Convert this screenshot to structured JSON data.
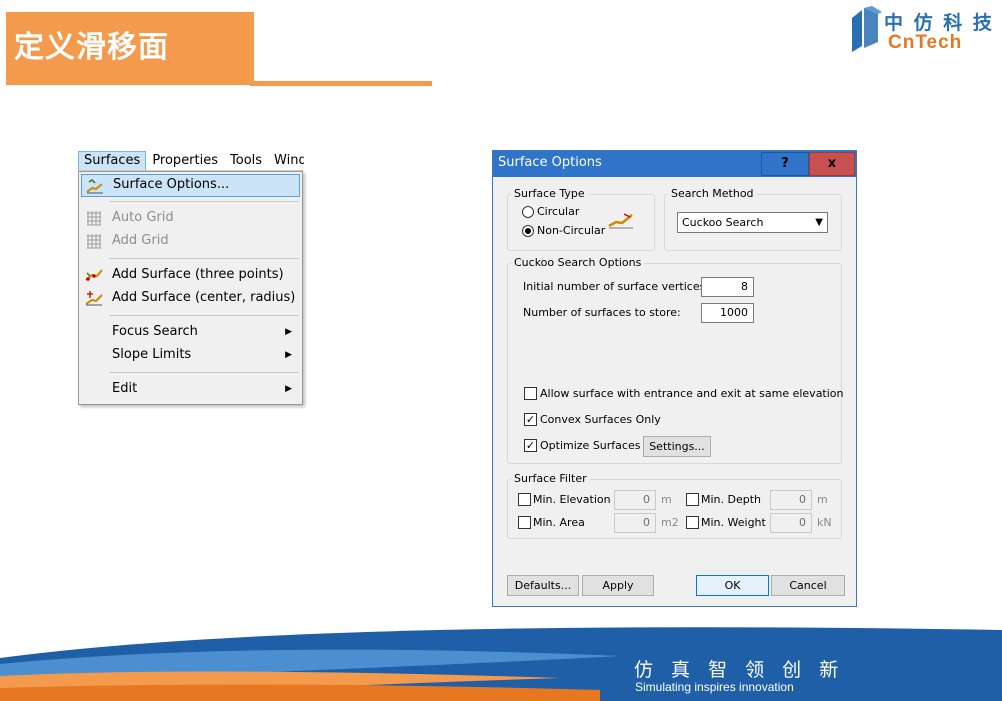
{
  "slide": {
    "title": "定义滑移面",
    "logo_cn": "中 仿 科 技",
    "logo_en": "CnTech",
    "slogan_cn": "仿 真 智 领 创 新",
    "slogan_en": "Simulating inspires innovation",
    "colors": {
      "accent": "#f39a4c",
      "brand_blue": "#2a6fb3",
      "brand_orange": "#e87722"
    }
  },
  "menubar": {
    "items": [
      "Surfaces",
      "Properties",
      "Tools",
      "Windo"
    ]
  },
  "menu": {
    "items": [
      {
        "label": "Surface Options...",
        "icon": "surface-options-icon"
      },
      {
        "label": "Auto Grid",
        "icon": "auto-grid-icon",
        "disabled": true
      },
      {
        "label": "Add Grid",
        "icon": "add-grid-icon",
        "disabled": true
      },
      {
        "label": "Add Surface (three points)",
        "icon": "add-surface-three-points-icon"
      },
      {
        "label": "Add Surface (center, radius)",
        "icon": "add-surface-center-radius-icon"
      },
      {
        "label": "Focus Search",
        "submenu": true
      },
      {
        "label": "Slope Limits",
        "submenu": true
      },
      {
        "label": "Edit",
        "submenu": true
      }
    ]
  },
  "dialog": {
    "title": "Surface Options",
    "help_button": "?",
    "close_button": "x",
    "surface_type": {
      "label": "Surface Type",
      "options": [
        "Circular",
        "Non-Circular"
      ],
      "selected": "Non-Circular"
    },
    "search_method": {
      "label": "Search Method",
      "value": "Cuckoo Search"
    },
    "cuckoo": {
      "label": "Cuckoo Search Options",
      "vertices_label": "Initial number of surface vertices:",
      "vertices_value": "8",
      "store_label": "Number of surfaces to store:",
      "store_value": "1000",
      "allow_same_elev": "Allow surface with entrance and exit at same elevation",
      "allow_same_elev_checked": false,
      "convex_only": "Convex Surfaces Only",
      "convex_only_checked": true,
      "optimize": "Optimize Surfaces",
      "optimize_checked": true,
      "settings_button": "Settings..."
    },
    "filter": {
      "label": "Surface Filter",
      "min_elevation": "Min. Elevation",
      "min_elevation_value": "0",
      "min_elevation_unit": "m",
      "min_depth": "Min. Depth",
      "min_depth_value": "0",
      "min_depth_unit": "m",
      "min_area": "Min. Area",
      "min_area_value": "0",
      "min_area_unit": "m2",
      "min_weight": "Min. Weight",
      "min_weight_value": "0",
      "min_weight_unit": "kN"
    },
    "buttons": {
      "defaults": "Defaults...",
      "apply": "Apply",
      "ok": "OK",
      "cancel": "Cancel"
    }
  }
}
